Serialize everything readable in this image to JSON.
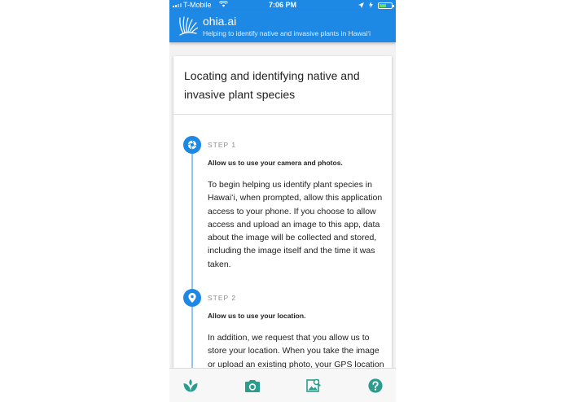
{
  "status_bar": {
    "carrier": "T-Mobile",
    "time": "7:06 PM"
  },
  "app_bar": {
    "title": "ohia.ai",
    "tagline": "Helping to identify native and invasive plants in Hawaiʻi"
  },
  "card": {
    "title": "Locating and identifying native and invasive plant species",
    "steps": [
      {
        "label": "STEP 1",
        "icon": "camera-shutter-icon",
        "heading": "Allow us to use your camera and photos.",
        "body": "To begin helping us identify plant species in Hawaiʻi, when prompted, allow this application access to your phone. If you choose to allow access and upload an image to this app, data about the image will be collected and stored, including the image itself and the time it was taken."
      },
      {
        "label": "STEP 2",
        "icon": "location-pin-icon",
        "heading": "Allow us to use your location.",
        "body": "In addition, we request that you allow us to store your location. When you take the image or upload an existing photo, your GPS location"
      }
    ]
  },
  "bottom_nav": [
    {
      "icon": "plant-icon"
    },
    {
      "icon": "camera-icon"
    },
    {
      "icon": "image-search-icon"
    },
    {
      "icon": "help-icon"
    }
  ],
  "colors": {
    "primary": "#1e88e5",
    "timeline": "#90c4f1",
    "nav_icon": "#2a9d8f"
  }
}
